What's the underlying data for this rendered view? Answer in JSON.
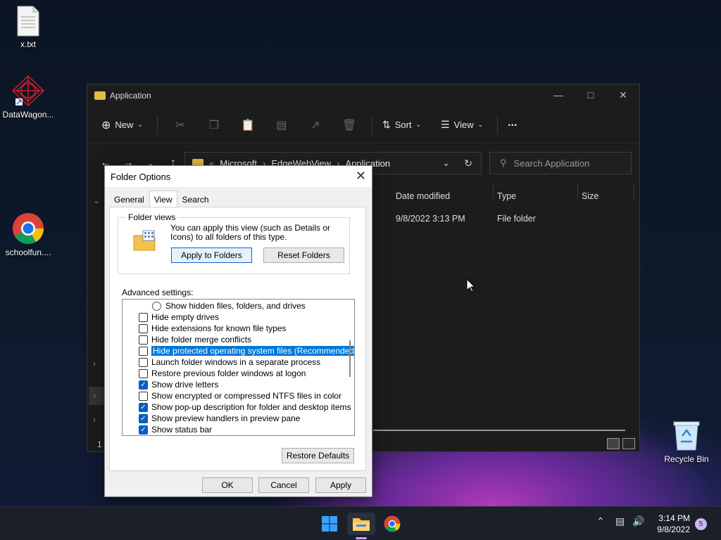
{
  "desktop": {
    "icons": [
      {
        "label": "x.txt"
      },
      {
        "label": "DataWagon..."
      },
      {
        "label": "schoolfun...."
      },
      {
        "label": "Recycle Bin"
      }
    ]
  },
  "explorer": {
    "title": "Application",
    "toolbar": {
      "new": "New",
      "sort": "Sort",
      "view": "View",
      "more": "..."
    },
    "breadcrumb": {
      "sep": "«",
      "items": [
        "Microsoft",
        "EdgeWebView",
        "Application"
      ]
    },
    "search_placeholder": "Search Application",
    "columns": [
      "Date modified",
      "Type",
      "Size"
    ],
    "rows": [
      {
        "date": "9/8/2022 3:13 PM",
        "type": "File folder"
      }
    ],
    "status_count": "1"
  },
  "dialog": {
    "title": "Folder Options",
    "tabs": [
      "General",
      "View",
      "Search"
    ],
    "folder_views": {
      "label": "Folder views",
      "description": "You can apply this view (such as Details or Icons) to all folders of this type.",
      "apply_button": "Apply to Folders",
      "reset_button": "Reset Folders"
    },
    "advanced_label": "Advanced settings:",
    "advanced_items": [
      {
        "label": "Show hidden files, folders, and drives",
        "kind": "radio",
        "checked": false
      },
      {
        "label": "Hide empty drives",
        "kind": "checkbox",
        "checked": false
      },
      {
        "label": "Hide extensions for known file types",
        "kind": "checkbox",
        "checked": false
      },
      {
        "label": "Hide folder merge conflicts",
        "kind": "checkbox",
        "checked": false
      },
      {
        "label": "Hide protected operating system files (Recommended)",
        "kind": "checkbox",
        "checked": false,
        "selected": true
      },
      {
        "label": "Launch folder windows in a separate process",
        "kind": "checkbox",
        "checked": false
      },
      {
        "label": "Restore previous folder windows at logon",
        "kind": "checkbox",
        "checked": false
      },
      {
        "label": "Show drive letters",
        "kind": "checkbox",
        "checked": true
      },
      {
        "label": "Show encrypted or compressed NTFS files in color",
        "kind": "checkbox",
        "checked": false
      },
      {
        "label": "Show pop-up description for folder and desktop items",
        "kind": "checkbox",
        "checked": true
      },
      {
        "label": "Show preview handlers in preview pane",
        "kind": "checkbox",
        "checked": true
      },
      {
        "label": "Show status bar",
        "kind": "checkbox",
        "checked": true
      }
    ],
    "restore_defaults": "Restore Defaults",
    "ok": "OK",
    "cancel": "Cancel",
    "apply": "Apply"
  },
  "taskbar": {
    "time": "3:14 PM",
    "date": "9/8/2022",
    "notifications": "5"
  }
}
